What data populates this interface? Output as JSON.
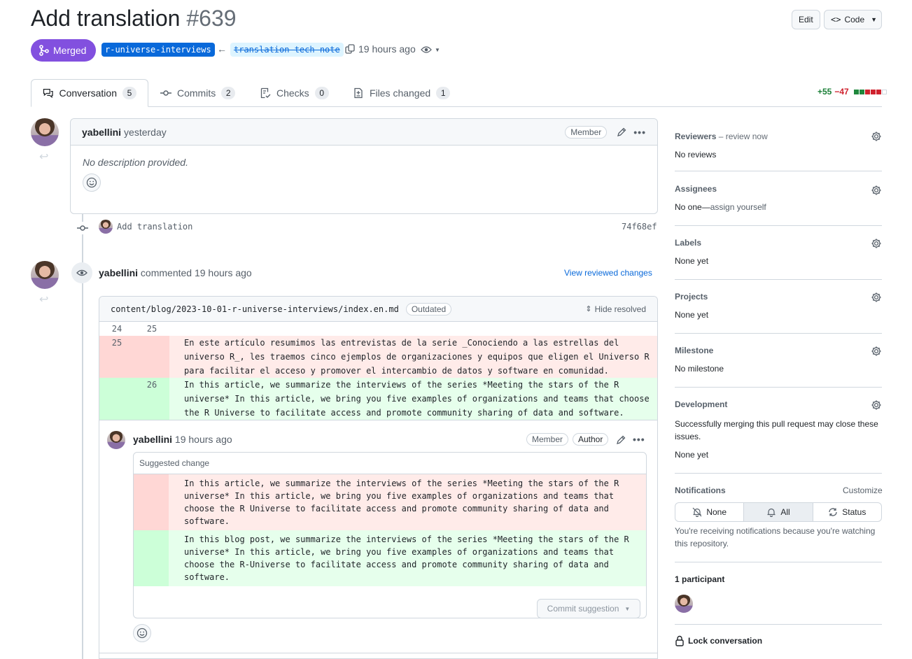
{
  "pr": {
    "title": "Add translation",
    "number": "#639",
    "state": "Merged",
    "base_branch": "r-universe-interviews",
    "head_branch": "translation-tech-note",
    "time": "19 hours ago"
  },
  "header_buttons": {
    "edit": "Edit",
    "code": "Code"
  },
  "tabs": [
    {
      "label": "Conversation",
      "count": "5"
    },
    {
      "label": "Commits",
      "count": "2"
    },
    {
      "label": "Checks",
      "count": "0"
    },
    {
      "label": "Files changed",
      "count": "1"
    }
  ],
  "diffstat": {
    "additions": "+55",
    "deletions": "−47"
  },
  "first_comment": {
    "author": "yabellini",
    "time": "yesterday",
    "badge": "Member",
    "body": "No description provided."
  },
  "commit": {
    "message": "Add translation",
    "sha": "74f68ef"
  },
  "review": {
    "author": "yabellini",
    "action": "commented 19 hours ago",
    "view_link": "View reviewed changes",
    "file_path": "content/blog/2023-10-01-r-universe-interviews/index.en.md",
    "outdated": "Outdated",
    "hide_resolved": "Hide resolved",
    "context_line": {
      "old": "24",
      "new": "25"
    },
    "removed": {
      "num": "25",
      "text": "En este artículo resumimos las entrevistas de la serie _Conociendo a las estrellas del universo R_, les traemos cinco ejemplos de organizaciones y equipos que eligen el Universo R para facilitar el acceso y promover el intercambio de datos y software en comunidad."
    },
    "added": {
      "num": "26",
      "text": "In this article, we summarize the interviews of the series *Meeting the stars of the R universe* In this article, we bring you five examples of organizations and teams that choose the R Universe to facilitate access and promote community sharing of data and software."
    }
  },
  "reply": {
    "author": "yabellini",
    "time": "19 hours ago",
    "badge_member": "Member",
    "badge_author": "Author",
    "suggested_label": "Suggested change",
    "old_text": "In this article, we summarize the interviews of the series *Meeting the stars of the R universe* In this article, we bring you five examples of organizations and teams that choose the R Universe to facilitate access and promote community sharing of data and software.",
    "new_text": "In this blog post, we summarize the interviews of the series *Meeting the stars of the R universe* In this article, we bring you five examples of organizations and teams that choose the R-Universe to facilitate access and promote community sharing of data and software.",
    "commit_button": "Commit suggestion"
  },
  "sidebar": {
    "reviewers": {
      "title": "Reviewers",
      "extra": " – review now",
      "value": "No reviews"
    },
    "assignees": {
      "title": "Assignees",
      "value": "No one—",
      "link": "assign yourself"
    },
    "labels": {
      "title": "Labels",
      "value": "None yet"
    },
    "projects": {
      "title": "Projects",
      "value": "None yet"
    },
    "milestone": {
      "title": "Milestone",
      "value": "No milestone"
    },
    "development": {
      "title": "Development",
      "desc": "Successfully merging this pull request may close these issues.",
      "value": "None yet"
    },
    "notifications": {
      "title": "Notifications",
      "customize": "Customize",
      "options": [
        "None",
        "All",
        "Status"
      ],
      "desc": "You're receiving notifications because you're watching this repository."
    },
    "participants": {
      "title": "1 participant"
    },
    "lock": "Lock conversation"
  },
  "colors": {
    "merged": "#8250df",
    "link": "#0969da",
    "add_bg": "#e6ffec",
    "del_bg": "#ffebe9"
  }
}
